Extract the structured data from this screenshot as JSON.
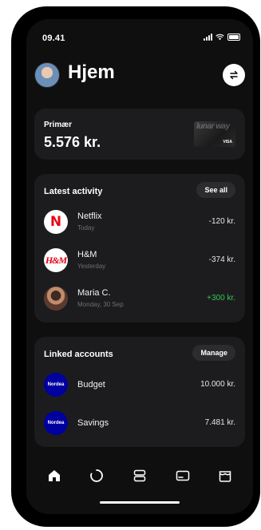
{
  "status_bar": {
    "time": "09.41"
  },
  "header": {
    "title": "Hjem"
  },
  "primary_account": {
    "label": "Primær",
    "balance": "5.576 kr.",
    "card_text": "lunar way",
    "card_network": "VISA"
  },
  "activity": {
    "title": "Latest activity",
    "see_all_label": "See all",
    "items": [
      {
        "name": "Netflix",
        "date": "Today",
        "amount": "-120 kr.",
        "icon": "netflix-logo",
        "logo_text": "N"
      },
      {
        "name": "H&M",
        "date": "Yesterday",
        "amount": "-374 kr.",
        "icon": "hm-logo",
        "logo_text": "H&M"
      },
      {
        "name": "Maria C.",
        "date": "Monday, 30 Sep",
        "amount": "+300 kr.",
        "icon": "person-avatar"
      }
    ]
  },
  "linked_accounts": {
    "title": "Linked accounts",
    "manage_label": "Manage",
    "items": [
      {
        "name": "Budget",
        "amount": "10.000 kr.",
        "bank_logo": "Nordea"
      },
      {
        "name": "Savings",
        "amount": "7.481 kr.",
        "bank_logo": "Nordea"
      }
    ]
  },
  "tab_bar": {
    "tabs": [
      "home-icon",
      "loading-icon",
      "accounts-icon",
      "card-icon",
      "store-icon"
    ]
  },
  "colors": {
    "background": "#0f0f10",
    "card": "#1c1c1e",
    "positive": "#34c759",
    "nordea_blue": "#0000a0"
  }
}
